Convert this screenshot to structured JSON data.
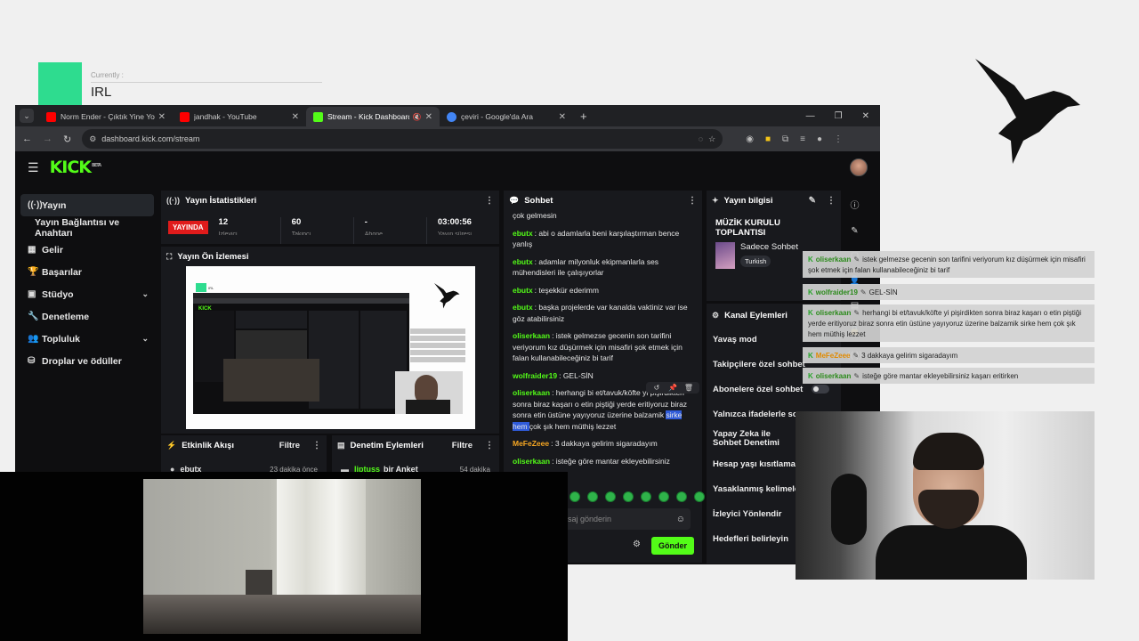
{
  "overlay": {
    "currently_label": "Currently :",
    "category": "IRL"
  },
  "browser": {
    "tabs": [
      {
        "title": "Norm Ender - Çıktık Yine Yollar",
        "favicon_color": "#ff0000"
      },
      {
        "title": "jandhak - YouTube",
        "favicon_color": "#ff0000"
      },
      {
        "title": "Stream - Kick Dashboard",
        "favicon_color": "#53fc18"
      },
      {
        "title": "çeviri - Google'da Ara",
        "favicon_color": "#4285f4"
      }
    ],
    "url": "dashboard.kick.com/stream"
  },
  "kick": {
    "logo": "KICK",
    "beta": "BETA"
  },
  "sidebar": {
    "items": [
      {
        "label": "Yayın",
        "icon": "broadcast-icon"
      },
      {
        "label": "Yayın Bağlantısı ve Anahtarı",
        "icon": ""
      },
      {
        "label": "Gelir",
        "icon": "revenue-icon"
      },
      {
        "label": "Başarılar",
        "icon": "trophy-icon"
      },
      {
        "label": "Stüdyo",
        "icon": "studio-icon"
      },
      {
        "label": "Denetleme",
        "icon": "wrench-icon"
      },
      {
        "label": "Topluluk",
        "icon": "community-icon"
      },
      {
        "label": "Droplar ve ödüller",
        "icon": "drops-icon"
      }
    ]
  },
  "stats": {
    "title": "Yayın İstatistikleri",
    "live_badge": "YAYINDA",
    "values": [
      {
        "value": "12",
        "cut_label": "İzleyici"
      },
      {
        "value": "60",
        "cut_label": "Takipçi"
      },
      {
        "value": "-",
        "cut_label": "Abone"
      },
      {
        "value": "03:00:56",
        "cut_label": "Yayın süresi"
      }
    ]
  },
  "preview": {
    "title": "Yayın Ön İzlemesi"
  },
  "activity": {
    "title": "Etkinlik Akışı",
    "filter": "Filtre",
    "row_user": "ebutx",
    "row_time": "23 dakika önce"
  },
  "moderation": {
    "title": "Denetim Eylemleri",
    "filter": "Filtre",
    "row_user": "liptuss",
    "row_text": "bir Anket",
    "row_time": "54 dakika"
  },
  "chat": {
    "title": "Sohbet",
    "top_text": "çok gelmesin",
    "messages": [
      {
        "user": "ebutx",
        "color": "green",
        "text": "abi o adamlarla beni karşılaştırman bence yanlış"
      },
      {
        "user": "ebutx",
        "color": "green",
        "text": "adamlar milyonluk ekipmanlarla ses mühendisleri ile çalışıyorlar"
      },
      {
        "user": "ebutx",
        "color": "green",
        "text": "teşekkür ederimm"
      },
      {
        "user": "ebutx",
        "color": "green",
        "text": "başka projelerde var kanalda vaktiniz var ise göz atabilirsiniz"
      },
      {
        "user": "oliserkaan",
        "color": "green",
        "text": "istek gelmezse gecenin son tarifini veriyorum kız düşürmek için misafiri şok etmek için falan kullanabileceğiniz bi tarif"
      },
      {
        "user": "wolfraider19",
        "color": "green",
        "text": "GEL-SİN"
      }
    ],
    "highlight_user": "oliserkaan",
    "highlight_pre": "herhangi bi et/tavuk/köfte yi pişirdikten sonra biraz kaşarı o etin piştiği yerde eritiyoruz biraz sonra etin üstüne yayıyoruz üzerine balzamik ",
    "highlight_sel": "sirke hem ",
    "highlight_post": "çok şık hem müthiş lezzet",
    "after": [
      {
        "user": "MeFeZeee",
        "color": "orange",
        "text": "3 dakkaya gelirim sigaradayım"
      },
      {
        "user": "oliserkaan",
        "color": "green",
        "text": "isteğe göre mantar ekleyebilirsiniz"
      }
    ],
    "input_placeholder": "saj gönderin",
    "send_label": "Gönder"
  },
  "info": {
    "title": "Yayın bilgisi",
    "stream_title": "MÜZİK KURULU TOPLANTISI",
    "category": "Sadece Sohbet",
    "tag": "Turkish"
  },
  "actions": {
    "title": "Kanal Eylemleri",
    "items": [
      "Yavaş mod",
      "Takipçilere özel sohbet",
      "Abonelere özel sohbet",
      "Yalnızca ifadelerle so",
      "Yapay Zeka ile Sohbet Denetimi",
      "Hesap yaşı kısıtlamas",
      "Yasaklanmış kelimele",
      "İzleyici Yönlendir",
      "Hedefleri belirleyin"
    ]
  },
  "overlay_chat": [
    {
      "user": "oliserkaan",
      "color": "green",
      "text": "istek gelmezse gecenin son tarifini veriyorum kız düşürmek için misafiri şok etmek için falan kullanabileceğiniz bi tarif"
    },
    {
      "user": "wolfraider19",
      "color": "green",
      "text": "GEL-SİN"
    },
    {
      "user": "oliserkaan",
      "color": "green",
      "text": "herhangi bi et/tavuk/köfte yi pişirdikten sonra biraz kaşarı o etin piştiği yerde eritiyoruz biraz sonra etin üstüne yayıyoruz üzerine balzamik sirke hem çok şık hem müthiş lezzet"
    },
    {
      "user": "MeFeZeee",
      "color": "orange",
      "text": "3 dakkaya gelirim sigaradayım"
    },
    {
      "user": "oliserkaan",
      "color": "green",
      "text": "isteğe göre mantar ekleyebilirsiniz kaşarı eritirken"
    }
  ]
}
